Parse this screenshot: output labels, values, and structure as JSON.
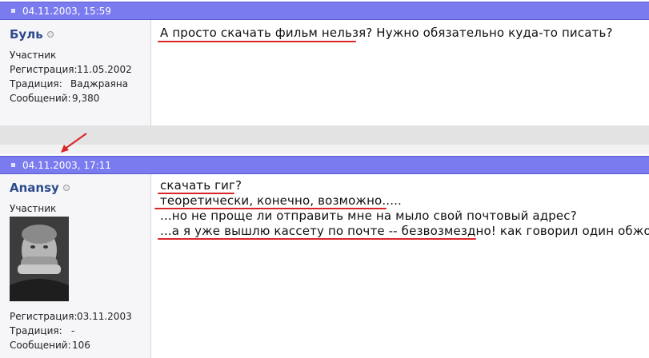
{
  "posts": [
    {
      "date": "04.11.2003, 15:59",
      "username": "Буль",
      "rank": "Участник",
      "info": [
        {
          "label": "Регистрация:",
          "value": "11.05.2002"
        },
        {
          "label": "Традиция:",
          "value": "Ваджраяна"
        },
        {
          "label": "Сообщений:",
          "value": "9,380"
        }
      ],
      "lines": [
        "А просто скачать фильм нельзя? Нужно обязательно куда-то писать?"
      ]
    },
    {
      "date": "04.11.2003, 17:11",
      "username": "Anansy",
      "rank": "Участник",
      "info": [
        {
          "label": "Регистрация:",
          "value": "03.11.2003"
        },
        {
          "label": "Традиция:",
          "value": "-"
        },
        {
          "label": "Сообщений:",
          "value": "106"
        }
      ],
      "lines": [
        "скачать гиг?",
        "теоретически, конечно, возможно.....",
        "...но не проще ли отправить мне на мыло свой почтовый адрес?",
        "...а я уже вышлю кассету по почте -- безвозмездно! как говорил один обжора..."
      ]
    }
  ],
  "colors": {
    "header_bg": "#7b7bf0",
    "username": "#2d4a8c",
    "annotation": "#d8252a"
  }
}
